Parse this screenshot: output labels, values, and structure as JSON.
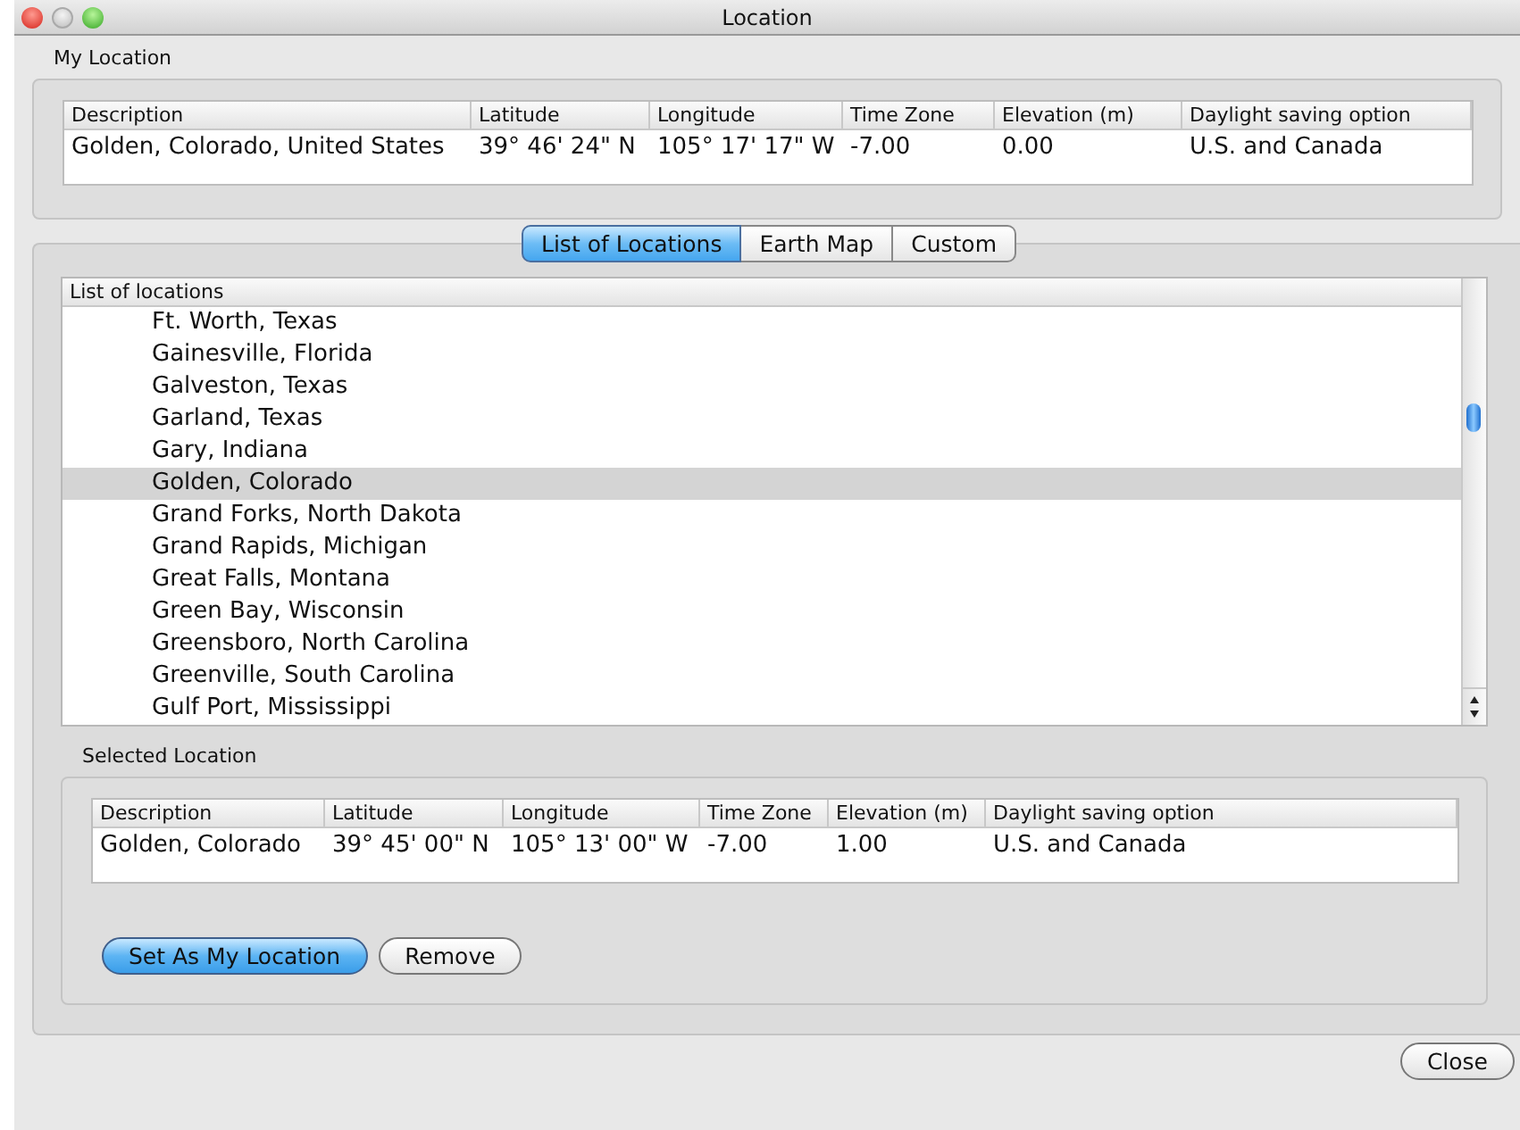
{
  "window": {
    "title": "Location"
  },
  "my_location": {
    "label": "My Location",
    "columns": [
      "Description",
      "Latitude",
      "Longitude",
      "Time Zone",
      "Elevation (m)",
      "Daylight saving option"
    ],
    "rows": [
      [
        "Golden, Colorado, United States",
        "39° 46' 24\" N",
        "105° 17' 17\" W",
        "-7.00",
        "0.00",
        "U.S. and Canada"
      ]
    ]
  },
  "tabs": [
    {
      "label": "List of Locations",
      "selected": true
    },
    {
      "label": "Earth Map",
      "selected": false
    },
    {
      "label": "Custom",
      "selected": false
    }
  ],
  "locations": {
    "header": "List of locations",
    "rows": [
      {
        "name": "Ft. Worth, Texas",
        "selected": false
      },
      {
        "name": "Gainesville, Florida",
        "selected": false
      },
      {
        "name": "Galveston, Texas",
        "selected": false
      },
      {
        "name": "Garland, Texas",
        "selected": false
      },
      {
        "name": "Gary, Indiana",
        "selected": false
      },
      {
        "name": "Golden, Colorado",
        "selected": true
      },
      {
        "name": "Grand Forks, North Dakota",
        "selected": false
      },
      {
        "name": "Grand Rapids, Michigan",
        "selected": false
      },
      {
        "name": "Great Falls, Montana",
        "selected": false
      },
      {
        "name": "Green Bay, Wisconsin",
        "selected": false
      },
      {
        "name": "Greensboro, North Carolina",
        "selected": false
      },
      {
        "name": "Greenville, South Carolina",
        "selected": false
      },
      {
        "name": "Gulf Port, Mississippi",
        "selected": false
      }
    ]
  },
  "selected_location": {
    "label": "Selected Location",
    "columns": [
      "Description",
      "Latitude",
      "Longitude",
      "Time Zone",
      "Elevation (m)",
      "Daylight saving option"
    ],
    "rows": [
      [
        "Golden, Colorado",
        "39° 45' 00\" N",
        "105° 13' 00\" W",
        "-7.00",
        "1.00",
        "U.S. and Canada"
      ]
    ],
    "buttons": [
      {
        "label": "Set As My Location",
        "kind": "default"
      },
      {
        "label": "Remove",
        "kind": "normal"
      }
    ]
  },
  "close_button": "Close"
}
